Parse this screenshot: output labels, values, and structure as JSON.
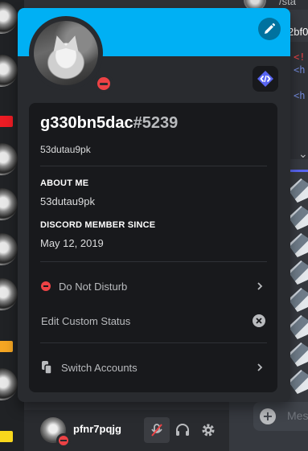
{
  "profile": {
    "username": "g330bn5dac",
    "discriminator": "#5239",
    "custom_status": "53dutau9pk",
    "about_me_title": "ABOUT ME",
    "about_me_text": "53dutau9pk",
    "member_since_title": "DISCORD MEMBER SINCE",
    "member_since_date": "May 12, 2019",
    "banner_color": "#00b0f4",
    "status": "dnd"
  },
  "menu": {
    "status_label": "Do Not Disturb",
    "edit_status_label": "Edit Custom Status",
    "switch_accounts_label": "Switch Accounts"
  },
  "user_panel": {
    "username": "pfnr7pqjg"
  },
  "chat": {
    "top_text": "/sta",
    "code_header": "2bf0",
    "code_lines": [
      "<!",
      "<h",
      "<h"
    ],
    "input_placeholder": "Mes"
  },
  "icons": {
    "edit": "pencil-icon",
    "badge": "hypesquad-code-badge-icon",
    "dnd": "do-not-disturb-icon",
    "close": "close-circle-icon",
    "switch": "switch-accounts-icon",
    "mute": "mic-muted-icon",
    "deafen": "headphones-icon",
    "settings": "gear-icon"
  },
  "colors": {
    "dnd_red": "#ed4245",
    "accent_blue": "#5865f2"
  }
}
